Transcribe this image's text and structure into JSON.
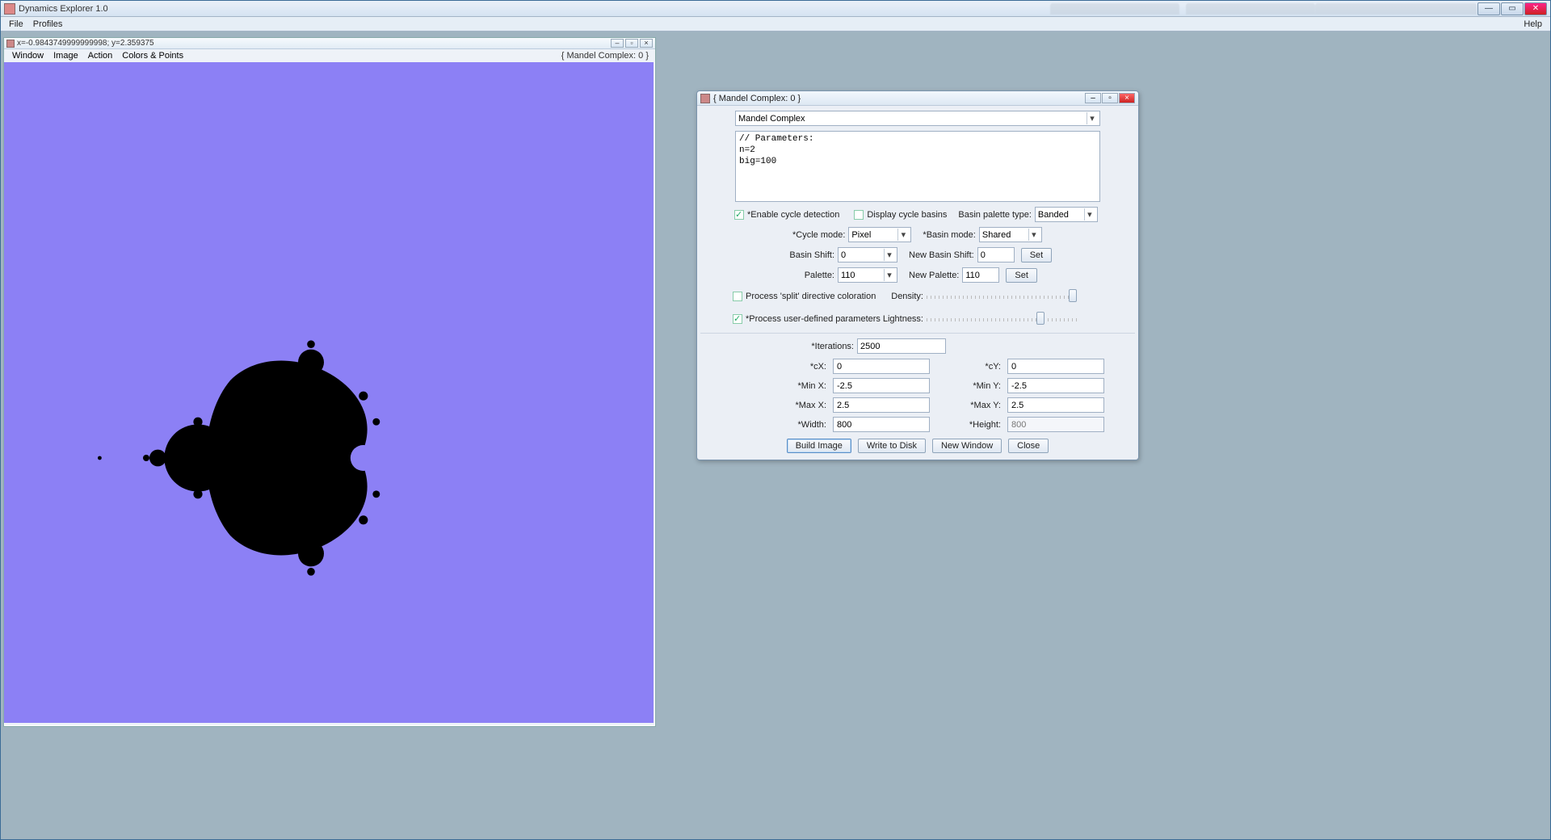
{
  "app": {
    "title": "Dynamics Explorer 1.0"
  },
  "main_menu": {
    "file": "File",
    "profiles": "Profiles",
    "help": "Help"
  },
  "image_window": {
    "title": "x=-0.9843749999999998; y=2.359375",
    "menu": {
      "window": "Window",
      "image": "Image",
      "action": "Action",
      "colors": "Colors & Points"
    },
    "badge": "{ Mandel Complex: 0 }"
  },
  "dialog": {
    "title": "{ Mandel Complex: 0 }",
    "system_select": "Mandel Complex",
    "params_text": "// Parameters:\nn=2\nbig=100",
    "enable_cycle_detection_label": "*Enable cycle detection",
    "enable_cycle_detection_checked": true,
    "display_cycle_basins_label": "Display cycle basins",
    "display_cycle_basins_checked": false,
    "basin_palette_type_label": "Basin palette type:",
    "basin_palette_type": "Banded",
    "cycle_mode_label": "*Cycle mode:",
    "cycle_mode": "Pixel",
    "basin_mode_label": "*Basin mode:",
    "basin_mode": "Shared",
    "basin_shift_label": "Basin Shift:",
    "basin_shift": "0",
    "new_basin_shift_label": "New Basin Shift:",
    "new_basin_shift": "0",
    "set_label": "Set",
    "palette_label": "Palette:",
    "palette": "110",
    "new_palette_label": "New Palette:",
    "new_palette": "110",
    "process_split_label": "Process 'split' directive coloration",
    "process_split_checked": false,
    "density_label": "Density:",
    "process_user_params_label": "*Process user-defined parameters",
    "process_user_params_checked": true,
    "lightness_label": "Lightness:",
    "iterations_label": "*Iterations:",
    "iterations": "2500",
    "cx_label": "*cX:",
    "cx": "0",
    "cy_label": "*cY:",
    "cy": "0",
    "minx_label": "*Min X:",
    "minx": "-2.5",
    "miny_label": "*Min Y:",
    "miny": "-2.5",
    "maxx_label": "*Max X:",
    "maxx": "2.5",
    "maxy_label": "*Max Y:",
    "maxy": "2.5",
    "width_label": "*Width:",
    "width": "800",
    "height_label": "*Height:",
    "height": "800",
    "buttons": {
      "build": "Build Image",
      "write": "Write to Disk",
      "neww": "New Window",
      "close": "Close"
    }
  }
}
